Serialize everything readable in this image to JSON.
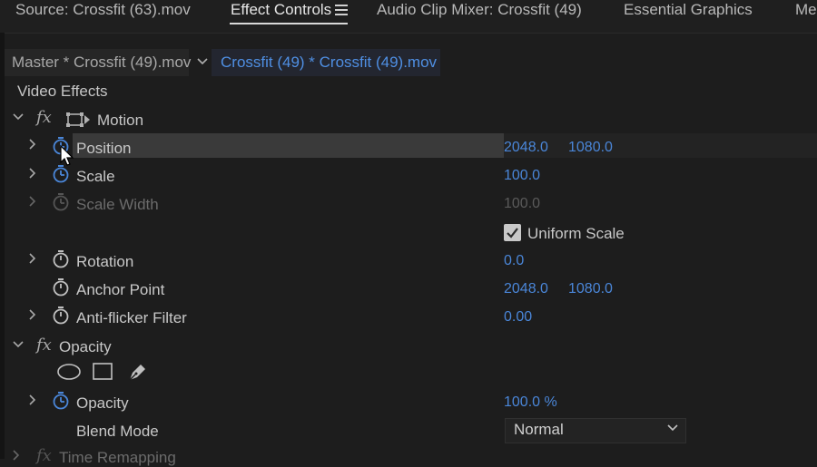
{
  "tabs": [
    {
      "label": "Source: Crossfit (63).mov"
    },
    {
      "label": "Effect Controls"
    },
    {
      "label": "Audio Clip Mixer: Crossfit (49)"
    },
    {
      "label": "Essential Graphics"
    },
    {
      "label": "Me"
    }
  ],
  "clip_bar": {
    "master": "Master * Crossfit (49).mov",
    "clip": "Crossfit (49) * Crossfit (49).mov"
  },
  "video_effects": {
    "header": "Video Effects",
    "motion": {
      "fx_symbol": "fx",
      "label": "Motion",
      "position": {
        "label": "Position",
        "x": "2048.0",
        "y": "1080.0"
      },
      "scale": {
        "label": "Scale",
        "value": "100.0"
      },
      "scale_width": {
        "label": "Scale Width",
        "value": "100.0"
      },
      "uniform_scale": {
        "label": "Uniform Scale",
        "checked": true
      },
      "rotation": {
        "label": "Rotation",
        "value": "0.0"
      },
      "anchor_point": {
        "label": "Anchor Point",
        "x": "2048.0",
        "y": "1080.0"
      },
      "anti_flicker": {
        "label": "Anti-flicker Filter",
        "value": "0.00"
      }
    },
    "opacity": {
      "fx_symbol": "fx",
      "label": "Opacity",
      "mask_tools": [
        "ellipse-mask-icon",
        "rectangle-mask-icon",
        "pen-mask-icon"
      ],
      "opacity_prop": {
        "label": "Opacity",
        "value": "100.0 %"
      },
      "blend_mode": {
        "label": "Blend Mode",
        "value": "Normal"
      }
    },
    "time_remapping": {
      "fx_symbol": "fx",
      "label": "Time Remapping"
    }
  },
  "colors": {
    "accent_blue": "#4a86d8",
    "panel_bg": "#1d1d1d"
  }
}
